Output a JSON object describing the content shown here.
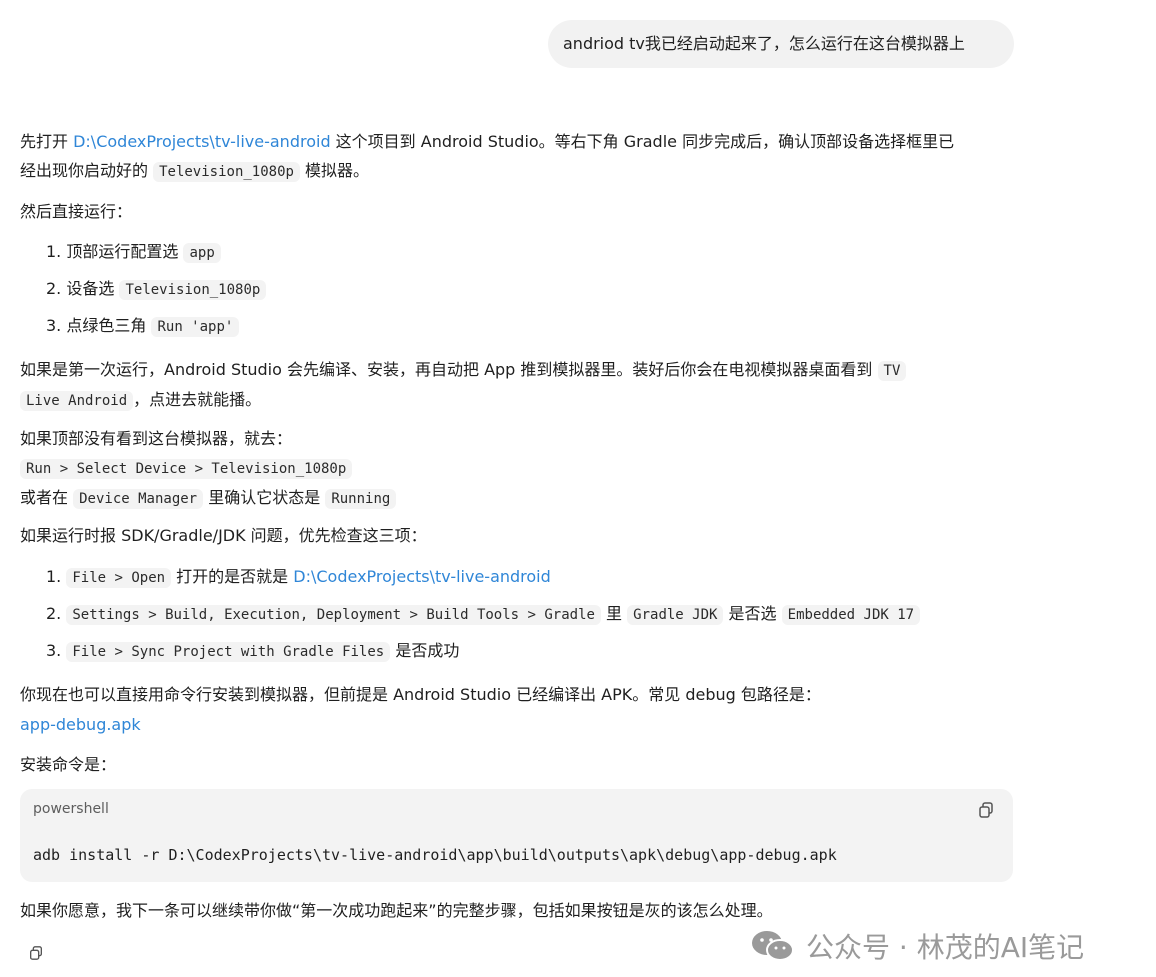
{
  "user_message": "andriod tv我已经启动起来了，怎么运行在这台模拟器上",
  "p1": {
    "a": "先打开 ",
    "link": "D:\\CodexProjects\\tv-live-android",
    "b": " 这个项目到 Android Studio。等右下角 Gradle 同步完成后，确认顶部设备选择框里已",
    "c": "经出现你启动好的 ",
    "code": "Television_1080p",
    "d": " 模拟器。"
  },
  "p2": "然后直接运行：",
  "steps": [
    {
      "num": "1.",
      "text": "顶部运行配置选",
      "code": "app"
    },
    {
      "num": "2.",
      "text": "设备选",
      "code": "Television_1080p"
    },
    {
      "num": "3.",
      "text": "点绿色三角",
      "code": "Run 'app'"
    }
  ],
  "p3": {
    "a": "如果是第一次运行，Android Studio 会先编译、安装，再自动把 App 推到模拟器里。装好后你会在电视模拟器桌面看到",
    "code1": "TV",
    "code2": "Live Android",
    "b": "，点进去就能播。"
  },
  "p4": "如果顶部没有看到这台模拟器，就去：",
  "p4_code": "Run > Select Device > Television_1080p",
  "p5": {
    "a": "或者在",
    "code1": "Device Manager",
    "b": "里确认它状态是",
    "code2": "Running"
  },
  "p6": "如果运行时报 SDK/Gradle/JDK 问题，优先检查这三项：",
  "checks": [
    {
      "num": "1.",
      "code": "File > Open",
      "text": "打开的是否就是",
      "link": "D:\\CodexProjects\\tv-live-android"
    },
    {
      "num": "2.",
      "code": "Settings > Build, Execution, Deployment > Build Tools > Gradle",
      "text": "里",
      "code2": "Gradle JDK",
      "text2": "是否选",
      "code3": "Embedded JDK 17"
    },
    {
      "num": "3.",
      "code": "File > Sync Project with Gradle Files",
      "text": "是否成功"
    }
  ],
  "p7": "你现在也可以直接用命令行安装到模拟器，但前提是 Android Studio 已经编译出 APK。常见 debug 包路径是：",
  "p7_link": "app-debug.apk",
  "p8": "安装命令是：",
  "codeblock": {
    "lang": "powershell",
    "code": "adb install -r D:\\CodexProjects\\tv-live-android\\app\\build\\outputs\\apk\\debug\\app-debug.apk"
  },
  "p9": "如果你愿意，我下一条可以继续带你做“第一次成功跑起来”的完整步骤，包括如果按钮是灰的该怎么处理。",
  "watermark": "公众号 · 林茂的AI笔记",
  "colors": {
    "link": "#2f86d7",
    "bubble": "#f2f2f2",
    "code_bg": "#f3f3f3"
  },
  "icons": [
    "copy-icon",
    "wechat-logo-icon"
  ]
}
